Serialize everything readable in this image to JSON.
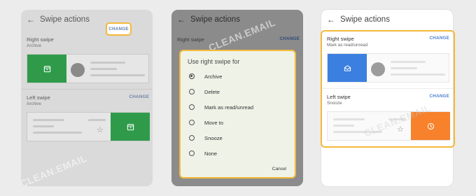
{
  "colors": {
    "highlight": "#f3b93a",
    "archive_green": "#2ca84f",
    "archive_green_dim": "#2f9b4a",
    "mark_read_blue": "#3b7fe0",
    "snooze_orange": "#f7822b"
  },
  "watermark": "CLEAN.EMAIL",
  "panel1": {
    "title": "Swipe actions",
    "right_swipe": {
      "label": "Right swipe",
      "value": "Archive",
      "change": "CHANGE",
      "icon": "archive-icon"
    },
    "left_swipe": {
      "label": "Left swipe",
      "value": "Archive",
      "change": "CHANGE",
      "icon": "archive-icon"
    }
  },
  "panel2": {
    "title": "Swipe actions",
    "right_swipe": {
      "label": "Right swipe",
      "change": "CHANGE"
    },
    "dialog": {
      "title": "Use right swipe for",
      "options": [
        "Archive",
        "Delete",
        "Mark as read/unread",
        "Move to",
        "Snooze",
        "None"
      ],
      "selected": "Archive",
      "cancel": "Cancel"
    }
  },
  "panel3": {
    "title": "Swipe actions",
    "right_swipe": {
      "label": "Right swipe",
      "value": "Mark as read/unread",
      "change": "CHANGE",
      "icon": "envelope-icon"
    },
    "left_swipe": {
      "label": "Left swipe",
      "value": "Snooze",
      "change": "CHANGE",
      "icon": "clock-icon"
    }
  }
}
